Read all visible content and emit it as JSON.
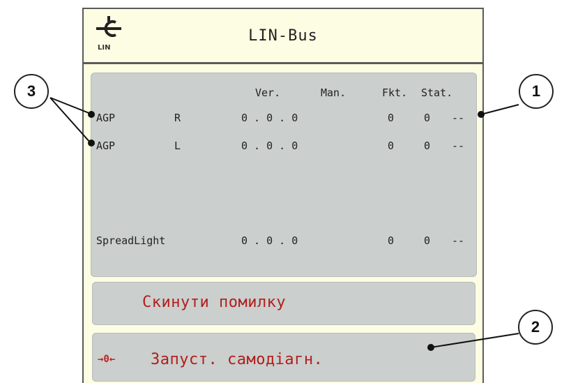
{
  "header": {
    "icon_name": "lin-bus-icon",
    "icon_label": "LIN",
    "title": "LIN-Bus"
  },
  "table": {
    "columns": [
      "Ver.",
      "Man.",
      "Fkt.",
      "Stat."
    ],
    "rows": [
      {
        "name": "AGP",
        "side": "R",
        "ver": "0 . 0 . 0",
        "man": "",
        "fkt": "0",
        "fkt2": "0",
        "stat": "--"
      },
      {
        "name": "AGP",
        "side": "L",
        "ver": "0 . 0 . 0",
        "man": "",
        "fkt": "0",
        "fkt2": "0",
        "stat": "--"
      },
      {
        "name": "SpreadLight",
        "side": "",
        "ver": "0 . 0 . 0",
        "man": "",
        "fkt": "0",
        "fkt2": "0",
        "stat": "--"
      }
    ]
  },
  "buttons": {
    "reset_label": "Скинути помилку",
    "selftest_icon": "→0←",
    "selftest_label": "Запуст. самодіагн."
  },
  "callouts": [
    "1",
    "2",
    "3"
  ],
  "colors": {
    "panel": "#cbcfcd",
    "background": "#fdfde3",
    "button_text": "#b01e1e"
  }
}
